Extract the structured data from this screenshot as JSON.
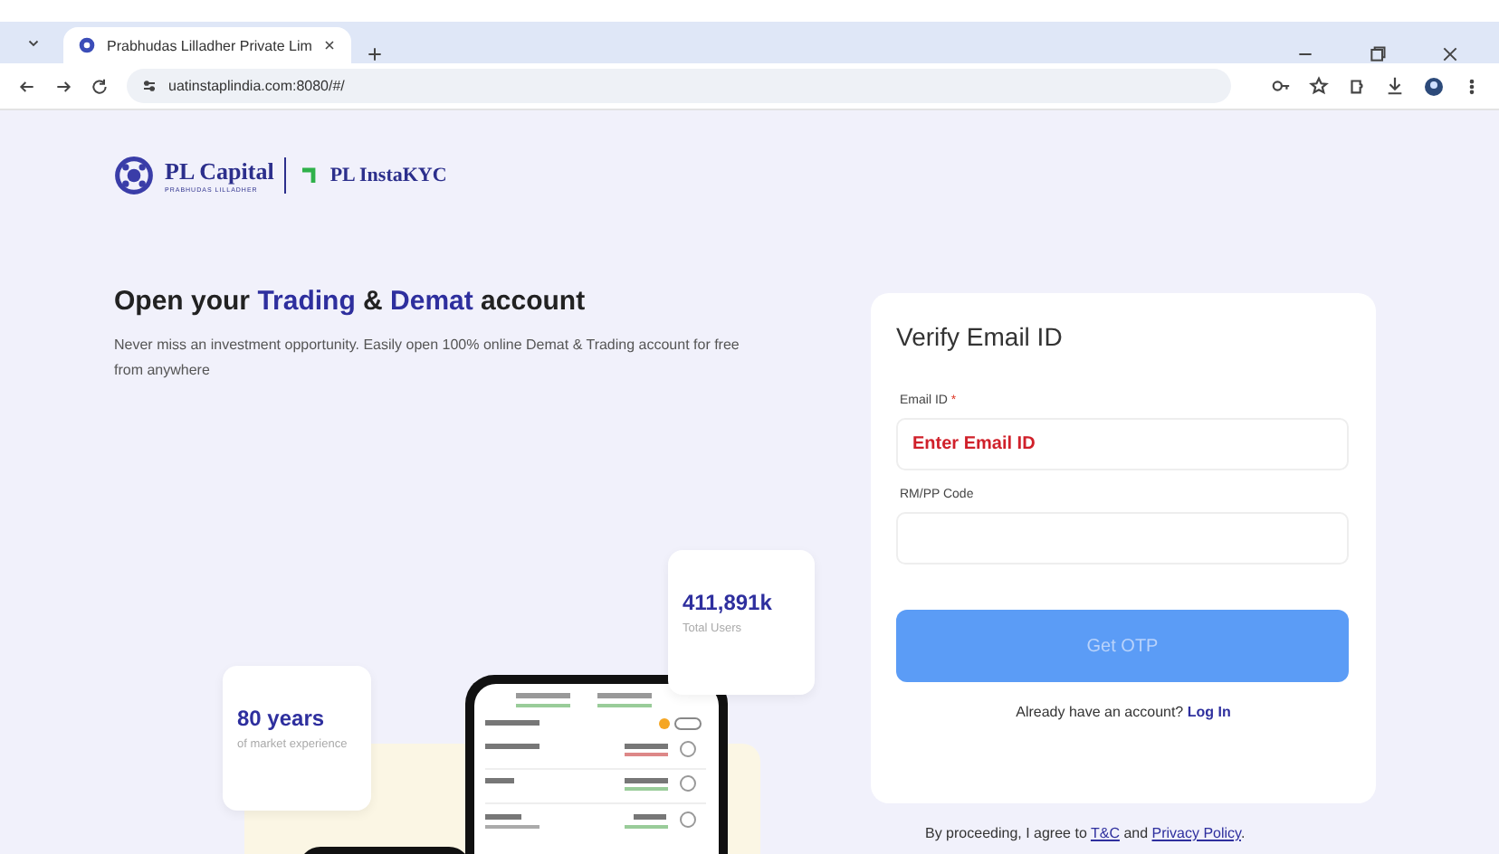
{
  "browser": {
    "tab": {
      "title": "Prabhudas Lilladher Private Lim",
      "selected": true
    },
    "url": "uatinstaplindia.com:8080/#/"
  },
  "logo": {
    "brand": "PL Capital",
    "tagline": "PRABHUDAS LILLADHER",
    "product": "PL InstaKYC"
  },
  "hero": {
    "heading": [
      {
        "text": "Open your ",
        "highlight": false
      },
      {
        "text": "Trading",
        "highlight": true
      },
      {
        "text": " & ",
        "highlight": false
      },
      {
        "text": "Demat",
        "highlight": true
      },
      {
        "text": " account",
        "highlight": false
      }
    ],
    "subtitle": "Never miss an investment opportunity. Easily open 100% online Demat & Trading account for free from anywhere"
  },
  "stats": [
    {
      "value": "411,891k",
      "label": "Total Users"
    },
    {
      "value": "80 years",
      "label": "of market experience"
    }
  ],
  "form": {
    "title": "Verify Email ID",
    "fields": [
      {
        "label": "Email ID",
        "required_mark": "*",
        "placeholder": "Enter Email ID",
        "invalid": true
      },
      {
        "label": "RM/PP Code"
      }
    ],
    "submit": {
      "label": "Get OTP",
      "disabled": true
    },
    "login_prompt": "Already have an account?",
    "login_link": "Log In"
  },
  "consent": [
    {
      "text": "By proceeding, I agree to ",
      "kind": "text"
    },
    {
      "text": "T&C",
      "kind": "link"
    },
    {
      "text": " and ",
      "kind": "text"
    },
    {
      "text": "Privacy Policy",
      "kind": "link"
    },
    {
      "text": ".",
      "kind": "text"
    }
  ]
}
